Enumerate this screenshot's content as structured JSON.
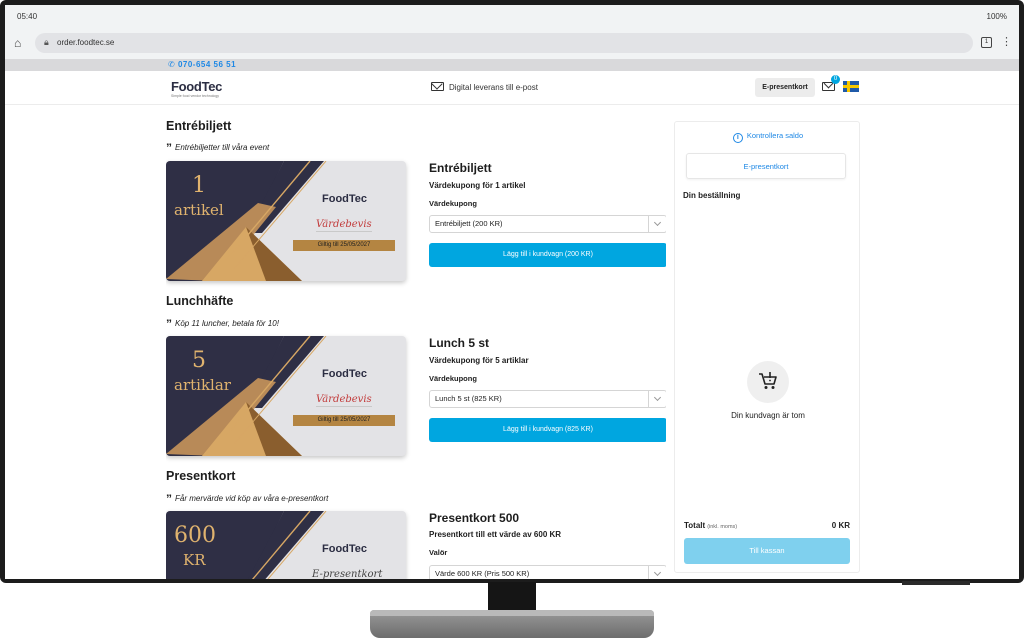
{
  "status": {
    "time": "05:40",
    "battery": "100%"
  },
  "browser": {
    "url": "order.foodtec.se",
    "tab_count": "1"
  },
  "site": {
    "phone": "070-654 56 51",
    "logo": "FoodTec",
    "logo_tagline": "Simple food vendor technology",
    "delivery_text": "Digital leverans till e-post",
    "egift_button": "E-presentkort",
    "cart_count": "0"
  },
  "sections": [
    {
      "title": "Entrébiljett",
      "subtitle": "Entrébiljetter till våra event",
      "card_num": "1",
      "card_unit": "artikel",
      "card_logo": "FoodTec",
      "card_script": "Värdebevis",
      "card_valid": "Giltig till 25/05/2027",
      "product_title": "Entrébiljett",
      "product_sub": "Värdekupong för 1 artikel",
      "select_label": "Värdekupong",
      "select_value": "Entrébiljett (200 KR)",
      "button": "Lägg till i kundvagn (200 KR)"
    },
    {
      "title": "Lunchhäfte",
      "subtitle": "Köp 11 luncher, betala för 10!",
      "card_num": "5",
      "card_unit": "artiklar",
      "card_logo": "FoodTec",
      "card_script": "Värdebevis",
      "card_valid": "Giltig till 25/05/2027",
      "product_title": "Lunch 5 st",
      "product_sub": "Värdekupong för 5 artiklar",
      "select_label": "Värdekupong",
      "select_value": "Lunch 5 st (825 KR)",
      "button": "Lägg till i kundvagn (825 KR)"
    },
    {
      "title": "Presentkort",
      "subtitle": "Får mervärde vid köp av våra e-presentkort",
      "card_num": "600",
      "card_unit": "KR",
      "card_logo": "FoodTec",
      "card_script": "E-presentkort",
      "product_title": "Presentkort 500",
      "product_sub": "Presentkort till ett värde av 600 KR",
      "select_label": "Valör",
      "select_value": "Värde 600 KR (Pris 500 KR)"
    }
  ],
  "sidebar": {
    "check_balance": "Kontrollera saldo",
    "egift_tab": "E-presentkort",
    "order_title": "Din beställning",
    "empty_text": "Din kundvagn är tom",
    "total_label": "Totalt",
    "total_note": "(inkl. moms)",
    "total_value": "0 KR",
    "checkout": "Till kassan"
  },
  "colors": {
    "accent": "#00a6e0",
    "card_dark": "#2f2f45",
    "gold": "#d4a15a"
  }
}
